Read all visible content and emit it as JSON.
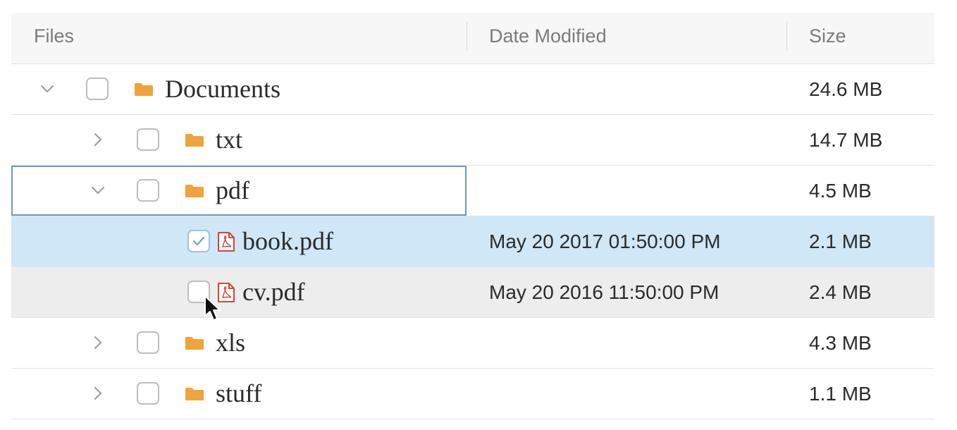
{
  "columns": {
    "files": "Files",
    "date_modified": "Date Modified",
    "size": "Size"
  },
  "rows": [
    {
      "name": "Documents",
      "date": "",
      "size": "24.6 MB",
      "type": "folder",
      "level": 0,
      "toggle": "expanded",
      "checked": false
    },
    {
      "name": "txt",
      "date": "",
      "size": "14.7 MB",
      "type": "folder",
      "level": 1,
      "toggle": "collapsed",
      "checked": false
    },
    {
      "name": "pdf",
      "date": "",
      "size": "4.5 MB",
      "type": "folder",
      "level": 1,
      "toggle": "expanded",
      "checked": false,
      "focused": true
    },
    {
      "name": "book.pdf",
      "date": "May 20 2017 01:50:00 PM",
      "size": "2.1 MB",
      "type": "pdf-file",
      "level": 2,
      "checked": true,
      "selected": true
    },
    {
      "name": "cv.pdf",
      "date": "May 20 2016 11:50:00 PM",
      "size": "2.4 MB",
      "type": "pdf-file",
      "level": 2,
      "checked": false,
      "hovered": true
    },
    {
      "name": "xls",
      "date": "",
      "size": "4.3 MB",
      "type": "folder",
      "level": 1,
      "toggle": "collapsed",
      "checked": false
    },
    {
      "name": "stuff",
      "date": "",
      "size": "1.1 MB",
      "type": "folder",
      "level": 1,
      "toggle": "collapsed",
      "checked": false
    }
  ],
  "colors": {
    "folder": "#f0a33a",
    "pdf": "#d2453a",
    "selected_row": "#cfe7f7",
    "hover_row": "#ededee",
    "focus_outline": "#6d96c6"
  },
  "icons": {
    "folder": "folder-icon",
    "pdf": "pdf-file-icon",
    "expanded": "chevron-down-icon",
    "collapsed": "chevron-right-icon",
    "check": "checkmark-icon",
    "pointer": "mouse-pointer-icon"
  }
}
